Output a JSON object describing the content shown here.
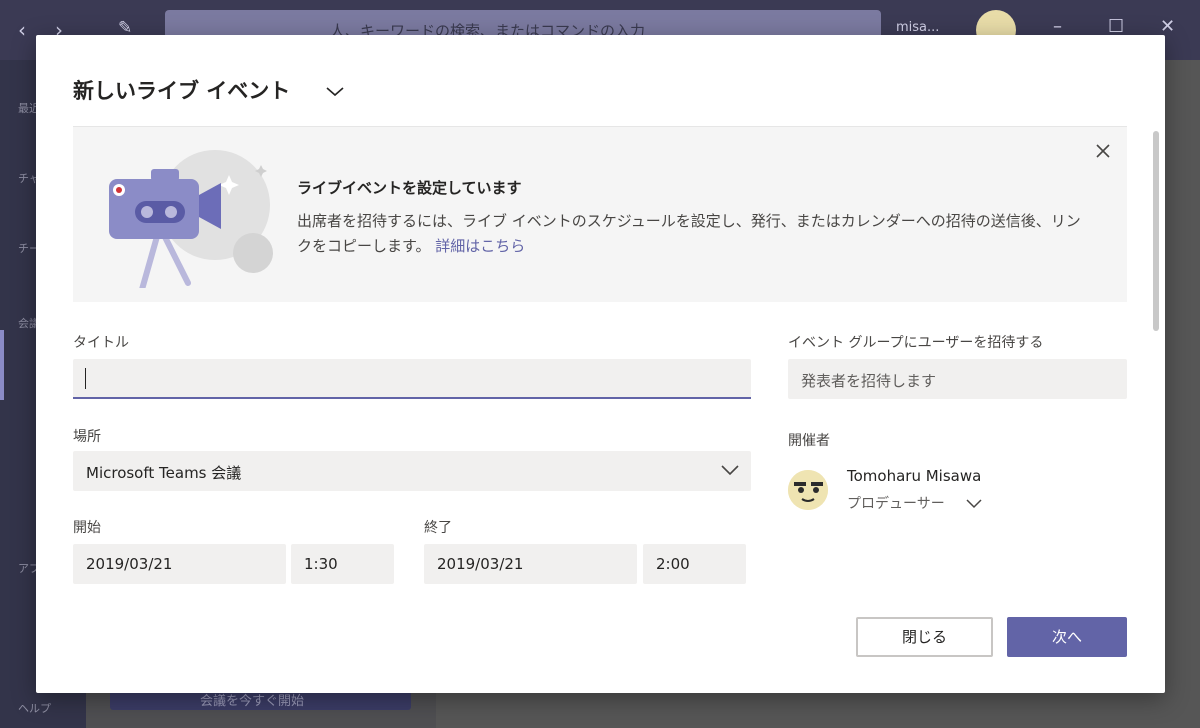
{
  "background_app": {
    "search_placeholder": "人、キーワードの検索、またはコマンドの入力",
    "user_short": "misa...",
    "rail_items": [
      "最近",
      "チャ",
      "チーム",
      "会議",
      "アプリ",
      "ヘルプ"
    ],
    "bg_button_label": "会議を今すぐ開始"
  },
  "dialog": {
    "title": "新しいライブ イベント",
    "banner": {
      "heading": "ライブイベントを設定しています",
      "body": "出席者を招待するには、ライブ イベントのスケジュールを設定し、発行、またはカレンダーへの招待の送信後、リンクをコピーします。",
      "link": "詳細はこちら"
    },
    "form": {
      "title_label": "タイトル",
      "title_value": "",
      "location_label": "場所",
      "location_value": "Microsoft Teams 会議",
      "start_label": "開始",
      "start_date": "2019/03/21",
      "start_time": "1:30",
      "end_label": "終了",
      "end_date": "2019/03/21",
      "end_time": "2:00"
    },
    "invite": {
      "label": "イベント グループにユーザーを招待する",
      "placeholder": "発表者を招待します"
    },
    "organizer": {
      "label": "開催者",
      "name": "Tomoharu Misawa",
      "role": "プロデューサー"
    },
    "buttons": {
      "close": "閉じる",
      "next": "次へ"
    }
  },
  "colors": {
    "accent": "#6264a7",
    "titlebar": "#3b3a54",
    "field_bg": "#f1f0ef",
    "banner_bg": "#f5f5f5"
  }
}
